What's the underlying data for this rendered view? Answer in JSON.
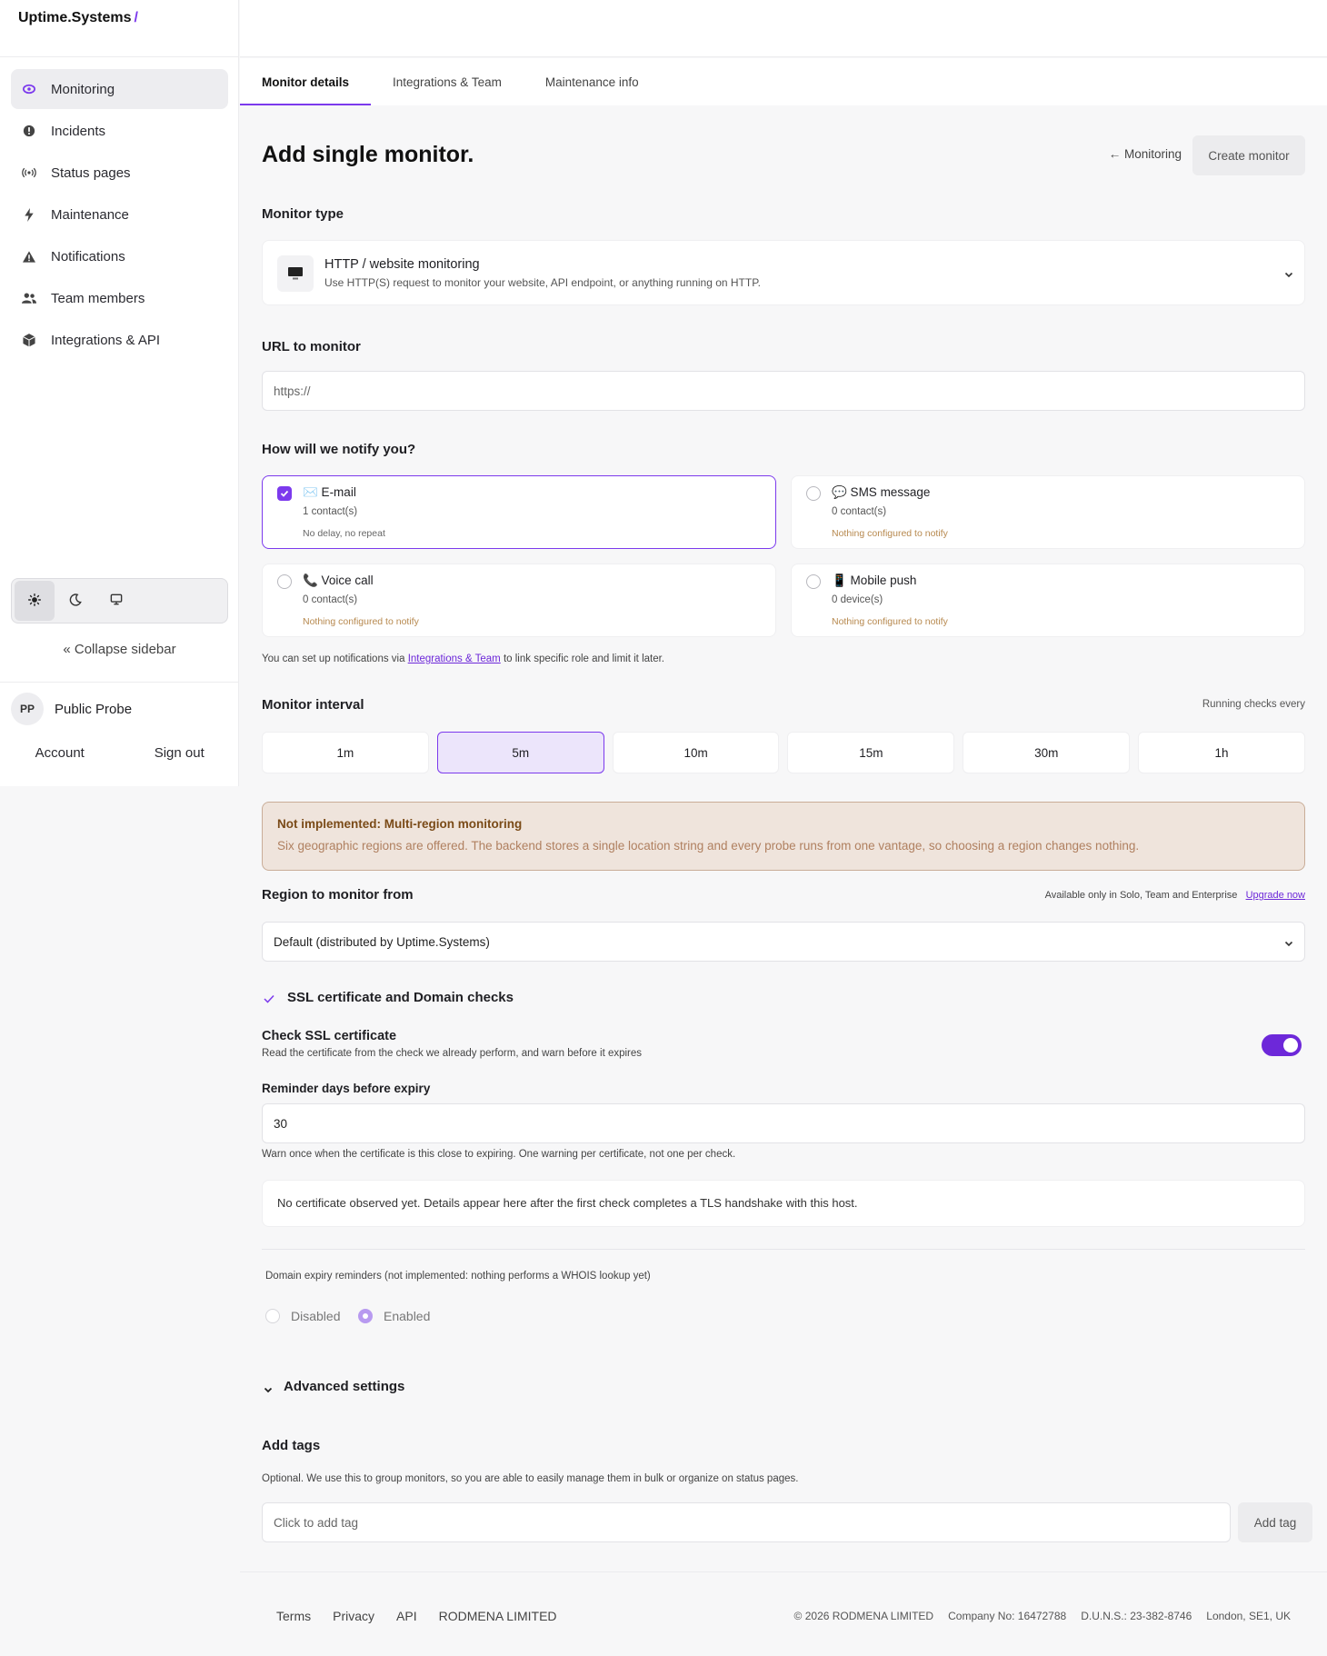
{
  "brand": {
    "name": "Uptime.Systems",
    "slash": "/"
  },
  "sidebar": {
    "items": [
      {
        "label": "Monitoring",
        "icon": "eye-icon"
      },
      {
        "label": "Incidents",
        "icon": "alert-circle-icon"
      },
      {
        "label": "Status pages",
        "icon": "broadcast-icon"
      },
      {
        "label": "Maintenance",
        "icon": "bolt-icon"
      },
      {
        "label": "Notifications",
        "icon": "warning-triangle-icon"
      },
      {
        "label": "Team members",
        "icon": "users-icon"
      },
      {
        "label": "Integrations & API",
        "icon": "cube-icon"
      }
    ],
    "theme_options": [
      "sun-icon",
      "moon-icon",
      "monitor-icon"
    ],
    "collapse_label": "«  Collapse sidebar",
    "user": {
      "initials": "PP",
      "name": "Public Probe"
    },
    "account_label": "Account",
    "signout_label": "Sign out"
  },
  "tabs": [
    "Monitor details",
    "Integrations & Team",
    "Maintenance info"
  ],
  "page": {
    "title": "Add single monitor.",
    "back_link": "← Monitoring",
    "create_button": "Create monitor"
  },
  "monitor_type": {
    "label": "Monitor type",
    "title": "HTTP / website monitoring",
    "description": "Use HTTP(S) request to monitor your website, API endpoint, or anything running on HTTP."
  },
  "url": {
    "label": "URL to monitor",
    "placeholder": "https://"
  },
  "notify": {
    "label": "How will we notify you?",
    "options": [
      {
        "title": "✉️ E-mail",
        "count": "1 contact(s)",
        "note": "No delay, no repeat",
        "checked": true
      },
      {
        "title": "💬 SMS message",
        "count": "0 contact(s)",
        "note": "Nothing configured to notify",
        "checked": false
      },
      {
        "title": "📞 Voice call",
        "count": "0 contact(s)",
        "note": "Nothing configured to notify",
        "checked": false
      },
      {
        "title": "📱 Mobile push",
        "count": "0 device(s)",
        "note": "Nothing configured to notify",
        "checked": false
      }
    ],
    "hint_prefix": "You can set up notifications via ",
    "hint_link": "Integrations & Team",
    "hint_suffix": " to link specific role and limit it later."
  },
  "interval": {
    "label": "Monitor interval",
    "right_label": "Running checks every",
    "options": [
      "1m",
      "5m",
      "10m",
      "15m",
      "30m",
      "1h"
    ],
    "selected": "5m"
  },
  "notice": {
    "title": "Not implemented: Multi-region monitoring",
    "body": "Six geographic regions are offered. The backend stores a single location string and every probe runs from one vantage, so choosing a region changes nothing."
  },
  "region": {
    "label": "Region to monitor from",
    "availability": "Available only in Solo, Team and Enterprise",
    "upgrade_link": "Upgrade now",
    "value": "Default (distributed by Uptime.Systems)"
  },
  "ssl": {
    "section_label": "SSL certificate and Domain checks",
    "check_title": "Check SSL certificate",
    "check_desc": "Read the certificate from the check we already perform, and warn before it expires",
    "toggle_on": true,
    "reminder_label": "Reminder days before expiry",
    "reminder_value": "30",
    "reminder_hint": "Warn once when the certificate is this close to expiring. One warning per certificate, not one per check.",
    "no_cert": "No certificate observed yet. Details appear here after the first check completes a TLS handshake with this host.",
    "domain_label": "Domain expiry reminders (not implemented: nothing performs a WHOIS lookup yet)",
    "domain_options": [
      "Disabled",
      "Enabled"
    ],
    "domain_selected": "Enabled"
  },
  "advanced": {
    "label": "Advanced settings"
  },
  "tags": {
    "label": "Add tags",
    "hint": "Optional. We use this to group monitors, so you are able to easily manage them in bulk or organize on status pages.",
    "placeholder": "Click to add tag",
    "button": "Add tag"
  },
  "footer": {
    "links": [
      "Terms",
      "Privacy",
      "API",
      "RODMENA LIMITED"
    ],
    "right": [
      "© 2026 RODMENA LIMITED",
      "Company No: 16472788",
      "D.U.N.S.: 23-382-8746",
      "London, SE1, UK"
    ]
  },
  "colors": {
    "accent": "#7c3aed",
    "notice_bg": "#efe4dc",
    "warn_text": "#b7894f"
  }
}
